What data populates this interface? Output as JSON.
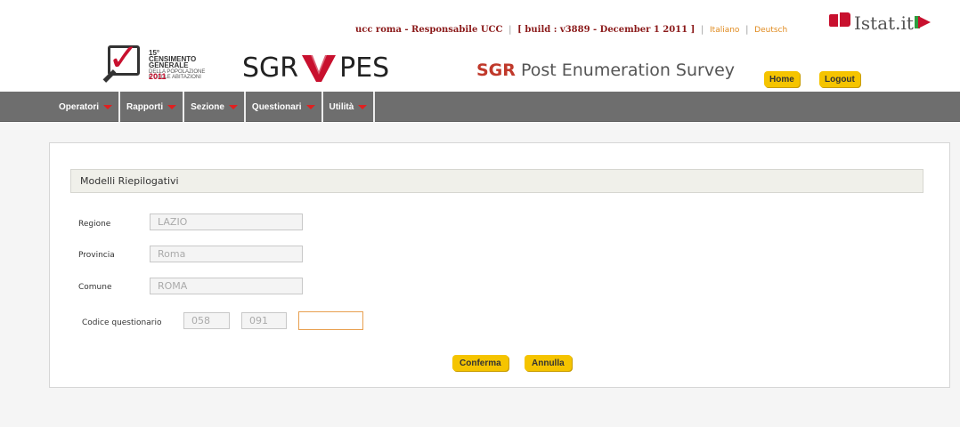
{
  "header": {
    "user_info": "ucc roma - Responsabile UCC",
    "build_info": "[ build : v3889 - December 1 2011 ]",
    "lang_it": "Italiano",
    "lang_de": "Deutsch",
    "istat_name": "Istat.it",
    "census_logo_line1": "15° CENSIMENTO GENERALE",
    "census_logo_line2": "DELLA POPOLAZIONE",
    "census_logo_line3": "E DELLE ABITAZIONI",
    "census_year": "2011",
    "sgr_left": "SGR",
    "sgr_right": "PES",
    "survey_sgr": "SGR",
    "survey_rest": " Post Enumeration Survey",
    "home_label": "Home",
    "logout_label": "Logout"
  },
  "nav": {
    "items": [
      {
        "label": "Operatori"
      },
      {
        "label": "Rapporti"
      },
      {
        "label": "Sezione"
      },
      {
        "label": "Questionari"
      },
      {
        "label": "Utilità"
      }
    ]
  },
  "panel": {
    "section_title": "Modelli Riepilogativi",
    "regione_label": "Regione",
    "regione_value": "LAZIO",
    "provincia_label": "Provincia",
    "provincia_value": "Roma",
    "comune_label": "Comune",
    "comune_value": "ROMA",
    "codice_label": "Codice questionario",
    "codice_part1": "058",
    "codice_part2": "091",
    "codice_part3": "",
    "confirm_label": "Conferma",
    "cancel_label": "Annulla"
  },
  "colors": {
    "accent_yellow": "#f5c400",
    "nav_gray": "#6e6e6e",
    "brand_red": "#c8102e"
  }
}
